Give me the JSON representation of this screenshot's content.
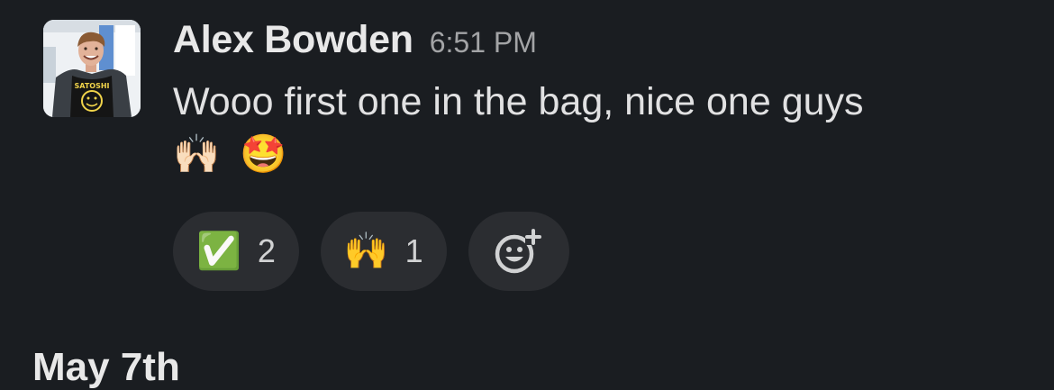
{
  "message": {
    "author": "Alex Bowden",
    "timestamp": "6:51 PM",
    "text": "Wooo first one in the bag, nice one guys",
    "inline_emojis": [
      "🙌🏻",
      "🤩"
    ],
    "reactions": [
      {
        "emoji": "✅",
        "count": "2",
        "icon": "check-mark-button-icon"
      },
      {
        "emoji": "🙌",
        "count": "1",
        "icon": "raising-hands-icon"
      }
    ],
    "add_reaction_icon": "add-reaction-icon",
    "avatar_shirt_text": "SATOSHI"
  },
  "date_divider": "May 7th",
  "colors": {
    "background": "#1a1d21",
    "reaction_pill": "#2b2d31"
  }
}
